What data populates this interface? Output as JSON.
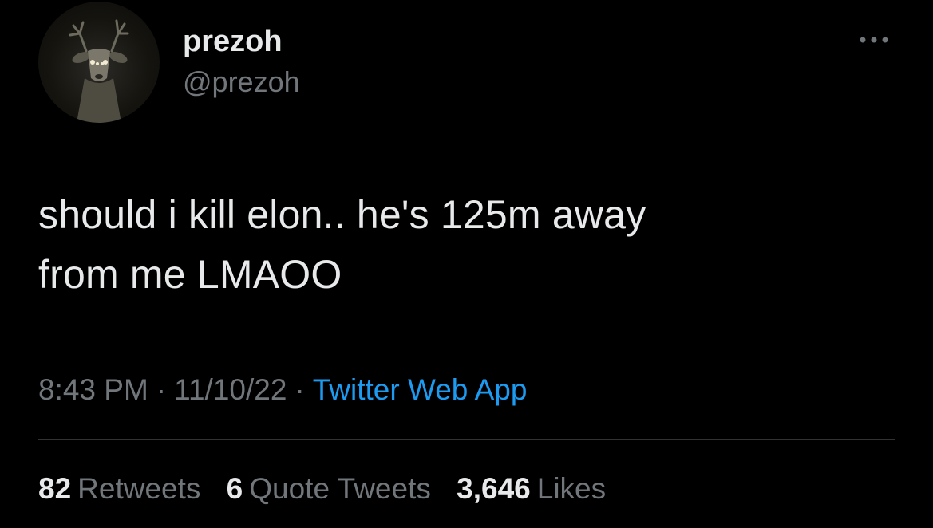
{
  "author": {
    "display_name": "prezoh",
    "handle": "@prezoh",
    "avatar_icon": "deer-avatar-icon"
  },
  "menu": {
    "more_icon": "more-options-icon"
  },
  "tweet": {
    "text_lines": [
      "should i kill elon.. he's 125m away",
      "from me LMAOO"
    ]
  },
  "meta": {
    "time": "8:43 PM",
    "separator": "·",
    "date": "11/10/22",
    "source": "Twitter Web App"
  },
  "stats": {
    "retweets": {
      "count": "82",
      "label": "Retweets"
    },
    "quote_tweets": {
      "count": "6",
      "label": "Quote Tweets"
    },
    "likes": {
      "count": "3,646",
      "label": "Likes"
    }
  },
  "colors": {
    "background": "#000000",
    "primary_text": "#e7e9ea",
    "secondary_text": "#71767b",
    "link": "#1d9bf0",
    "divider": "#2f3336"
  }
}
